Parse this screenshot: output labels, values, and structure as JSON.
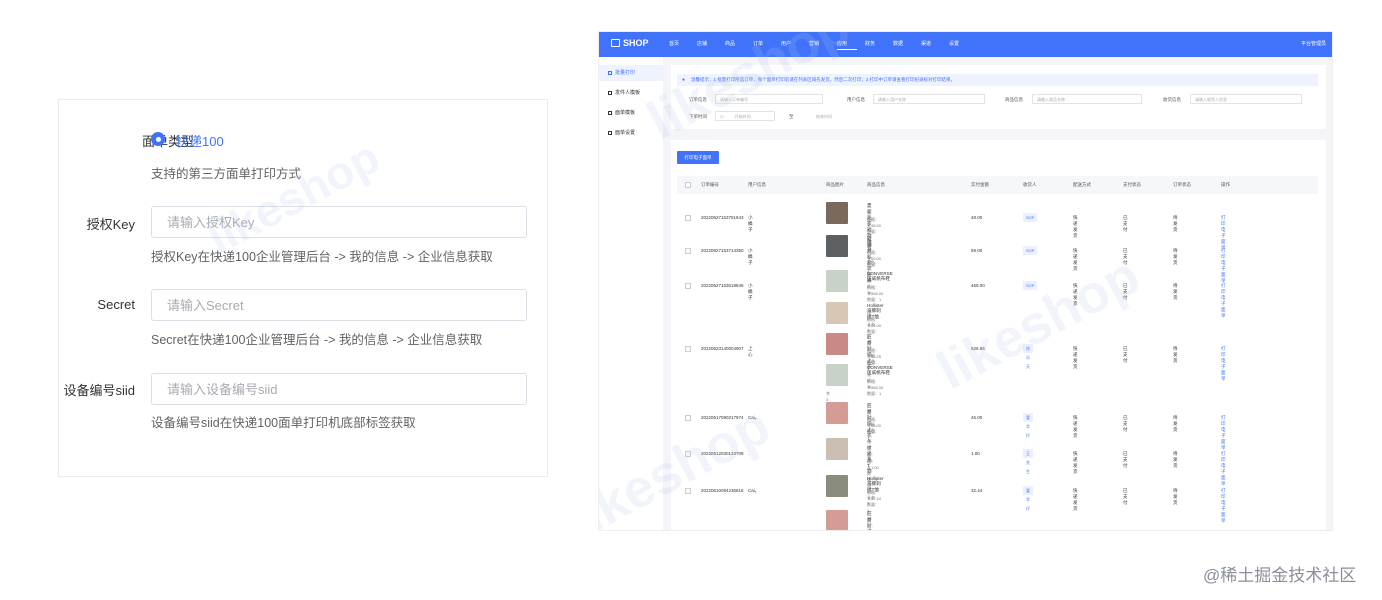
{
  "form": {
    "label_type": "面单类型",
    "radio_option": "快递100",
    "hint_type": "支持的第三方面单打印方式",
    "label_key": "授权Key",
    "placeholder_key": "请输入授权Key",
    "hint_key": "授权Key在快递100企业管理后台 -> 我的信息 -> 企业信息获取",
    "label_secret": "Secret",
    "placeholder_secret": "请输入Secret",
    "hint_secret": "Secret在快递100企业管理后台 -> 我的信息 -> 企业信息获取",
    "label_siid": "设备编号siid",
    "placeholder_siid": "请输入设备编号siid",
    "hint_siid": "设备编号siid在快递100面单打印机底部标签获取"
  },
  "admin_ui": {
    "brand": "SHOP",
    "admin_label": "平台管理员",
    "nav": [
      {
        "label": "首页",
        "active": false
      },
      {
        "label": "店铺",
        "active": false
      },
      {
        "label": "商品",
        "active": false
      },
      {
        "label": "订单",
        "active": false
      },
      {
        "label": "用户",
        "active": false
      },
      {
        "label": "营销",
        "active": false
      },
      {
        "label": "应用",
        "active": true
      },
      {
        "label": "财务",
        "active": false
      },
      {
        "label": "数据",
        "active": false
      },
      {
        "label": "渠道",
        "active": false
      },
      {
        "label": "设置",
        "active": false
      }
    ],
    "sidebar": [
      {
        "label": "批量打印",
        "active": true
      },
      {
        "label": "发件人模板",
        "active": false
      },
      {
        "label": "面单模板",
        "active": false
      },
      {
        "label": "面单设置",
        "active": false
      }
    ],
    "notice": "温馨提示：1.批量打印所选订单，每个面单打印前请在列表区域先发货，然后二次打印；2.打印中订单请查看打印纪录核对打印结果。",
    "filters": {
      "order_sn_label": "订单信息",
      "order_sn_placeholder": "请输入订单编号",
      "user_label": "用户信息",
      "user_placeholder": "请输入用户名称",
      "goods_label": "商品信息",
      "goods_placeholder": "请输入商品名称",
      "consignee_label": "收货信息",
      "consignee_placeholder": "请输入收货人信息",
      "time_label": "下单时间",
      "start_placeholder": "开始时间",
      "range_sep": "至",
      "end_placeholder": "结束时间",
      "query": "查询",
      "reset": "重置",
      "export": "导出"
    },
    "print_button": "打印电子面单",
    "columns": [
      "订单编号",
      "用户信息",
      "商品图片",
      "商品信息",
      "实付金额",
      "收货人",
      "配送方式",
      "支付状态",
      "订单状态",
      "操作"
    ],
    "rows": [
      {
        "sn": "20220627153751843",
        "user": "小橘子",
        "thumbs": [
          "#7a6a5e"
        ],
        "goods": [
          {
            "name": "夏装毛衣短款睡衣",
            "spec": "规格：S",
            "price": "价格：￥48.00  数量：1"
          }
        ],
        "paid": "48.00",
        "consignee": "SOP",
        "ship": "快递发货",
        "pay": "已支付",
        "status": "待发货",
        "op": "打印电子面单"
      },
      {
        "sn": "20220627153714350",
        "user": "小橘子",
        "thumbs": [
          "#5d6062"
        ],
        "goods": [
          {
            "name": "短袖衬衫套装短裤",
            "spec": "规格：M,白色",
            "price": "价格：￥59.00  数量：1"
          }
        ],
        "paid": "59.00",
        "consignee": "SOP",
        "ship": "快递发货",
        "pay": "已支付",
        "status": "待发货",
        "op": "打印电子面单"
      },
      {
        "sn": "20220627153618846",
        "user": "小橘子",
        "thumbs": [
          "#c9d2c8"
        ],
        "goods": [
          {
            "name": "CONVERSE匡威帆布鞋",
            "spec": "规格：36",
            "price": "价格：￥468.00  数量：1"
          }
        ],
        "paid": "469.00",
        "consignee": "SOP",
        "ship": "快递发货",
        "pay": "已支付",
        "status": "待发货",
        "op": "打印电子面单"
      },
      {
        "sn": "20220623140004907",
        "user": "上心",
        "thumbs": [
          "#d7c8b5",
          "#c98a86",
          "#c9d2c8"
        ],
        "goods": [
          {
            "name": "Hollister海豚刺绣T恤",
            "spec": "规格：头灰T",
            "price": "价格：￥23.00  数量：1"
          },
          {
            "name": "匠爵针织上衣",
            "spec": "规格：S,粉红色",
            "price": "价格：￥35.25  数量：1"
          },
          {
            "name": "CONVERSE匡威帆布鞋",
            "spec": "规格：36",
            "price": "价格：￥468.00  数量：1"
          }
        ],
        "more": "共3件商品",
        "paid": "526.65",
        "consignee": "徐乐天",
        "ship": "快递发货",
        "pay": "已支付",
        "status": "待发货",
        "op": "打印电子面单"
      },
      {
        "sn": "20220617090217974",
        "user": "Cai。",
        "thumbs": [
          "#d49c95"
        ],
        "goods": [
          {
            "name": "匠爵针织上衣",
            "spec": "规格：S,粉红色",
            "price": "价格：￥45.00  数量：1"
          }
        ],
        "paid": "46.00",
        "consignee": "爱华仔",
        "ship": "快递发货",
        "pay": "已支付",
        "status": "待发货",
        "op": "打印电子面单"
      },
      {
        "sn": "20220612030133709",
        "user": ".",
        "thumbs": [
          "#cbbfb3"
        ],
        "goods": [
          {
            "name": "条纹修身T恤",
            "spec": "规格：黑L",
            "price": "价格：￥1.00  数量：1"
          }
        ],
        "paid": "1.00",
        "consignee": "王先生",
        "ship": "快递发货",
        "pay": "已支付",
        "status": "待发货",
        "op": "打印电子面单"
      },
      {
        "sn": "20220610094236816",
        "user": "Cai。",
        "thumbs": [
          "#8a8d7e"
        ],
        "goods": [
          {
            "name": "Hollister海豚刺绣T恤",
            "spec": "规格：头灰T",
            "price": "价格：￥37.44  数量：1"
          }
        ],
        "paid": "32.44",
        "consignee": "爱华仔",
        "ship": "快递发货",
        "pay": "已支付",
        "status": "待发货",
        "op": "打印电子面单"
      },
      {
        "sn": "",
        "user": "",
        "thumbs": [
          "#d49c95"
        ],
        "goods": [
          {
            "name": "匠爵针织上衣",
            "spec": "规格：S,粉红色",
            "price": ""
          }
        ],
        "paid": "",
        "consignee": "",
        "ship": "",
        "pay": "",
        "status": "",
        "op": ""
      }
    ]
  },
  "watermark": "likeshop",
  "credit": "@稀土掘金技术社区",
  "colors": {
    "primary": "#4073fa",
    "page_bg": "#f4f5f9"
  }
}
